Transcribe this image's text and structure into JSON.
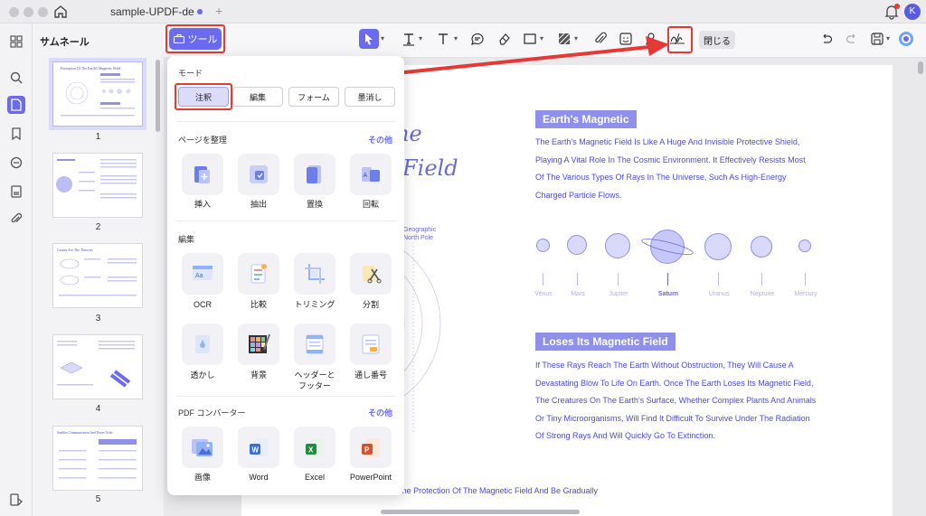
{
  "titlebar": {
    "doc_title": "sample-UPDF-de",
    "avatar_letter": "K"
  },
  "thumbnails": {
    "header": "サムネール",
    "pages": [
      {
        "num": "1",
        "heading": "Formation Of The Earth's Magnetic Field"
      },
      {
        "num": "2"
      },
      {
        "num": "3",
        "heading": "Causes For The Theories"
      },
      {
        "num": "4"
      },
      {
        "num": "5",
        "heading": "Satellite Communication And Power Grids"
      }
    ]
  },
  "toolbar": {
    "tools_label": "ツール",
    "close_label": "閉じる"
  },
  "panel": {
    "mode_header": "モード",
    "modes": [
      "注釈",
      "編集",
      "フォーム",
      "墨消し"
    ],
    "organize_header": "ページを整理",
    "organize_more": "その他",
    "organize_tools": [
      "挿入",
      "抽出",
      "置換",
      "回転"
    ],
    "edit_header": "編集",
    "edit_tools_row1": [
      "OCR",
      "比較",
      "トリミング",
      "分割"
    ],
    "edit_tools_row2": [
      "透かし",
      "背景",
      "ヘッダーと\nフッター",
      "通し番号"
    ],
    "converter_header": "PDF コンバーター",
    "converter_more": "その他",
    "converter_tools": [
      "画像",
      "Word",
      "Excel",
      "PowerPoint"
    ]
  },
  "document": {
    "partial_title_1": "ne",
    "partial_title_2": "Field",
    "geo_label_1": "Geographic",
    "geo_label_2": "North Pole",
    "section1_title": "Earth's Magnetic",
    "section1_text": "The Earth's Magnetic Field Is Like A Huge And Invisible Protective Shield, Playing A Vital Role In The Cosmic Environment. It Effectively Resists Most Of The Various Types Of Rays In The Universe, Such As High-Energy Charged Particle Flows.",
    "planets": [
      "Venus",
      "Mars",
      "Jupiter",
      "Saturn",
      "Uranus",
      "Neptune",
      "Mercury"
    ],
    "section2_title": "Loses Its Magnetic Field",
    "section2_text": "If These Rays Reach The Earth Without Obstruction, They Will Cause A Devastating Blow To Life On Earth. Once The Earth Loses Its Magnetic Field, The Creatures On The Earth's Surface, Whether Complex Plants And Animals Or Tiny Microorganisms, Will Find It Difficult To Survive Under The Radiation Of Strong Rays And Will Quickly Go To Extinction.",
    "footer_text": "At The Same Time, The Atmosphere Will Also Lose The Protection Of The Magnetic Field And Be Gradually"
  },
  "colors": {
    "accent": "#6b6bf0",
    "highlight_box": "#e53935",
    "doc_text": "#4b4bd6",
    "section_bg": "#8f90ea"
  }
}
